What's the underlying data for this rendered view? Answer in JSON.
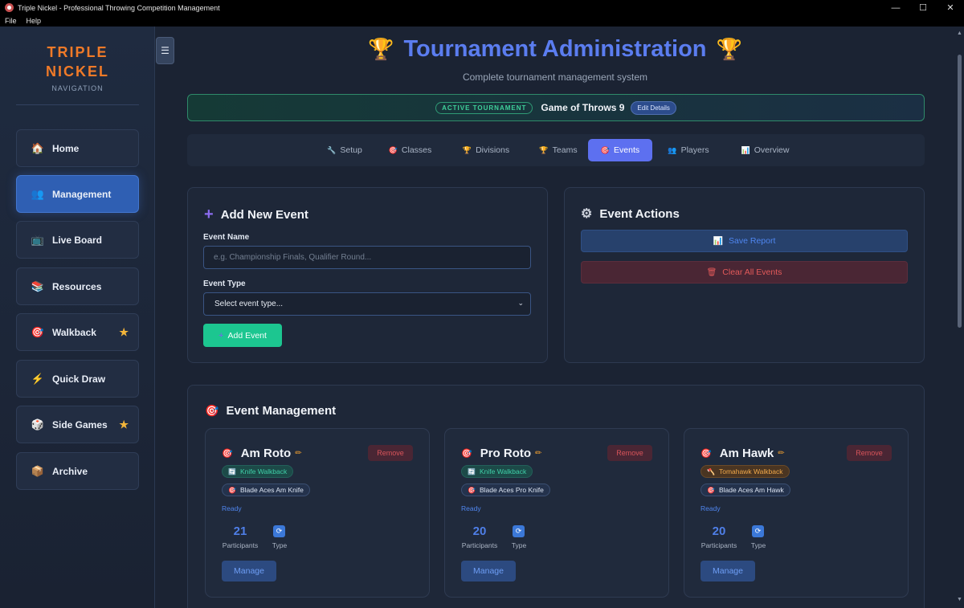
{
  "window": {
    "title": "Triple Nickel - Professional Throwing Competition Management",
    "controls": [
      "—",
      "☐",
      "✕"
    ]
  },
  "menu": [
    "File",
    "Help"
  ],
  "sidebar": {
    "brand_line1": "TRIPLE",
    "brand_line2": "NICKEL",
    "brand_sub": "NAVIGATION",
    "items": [
      {
        "label": "Home",
        "icon": "🏠",
        "icon_name": "home-icon",
        "active": false,
        "star": false
      },
      {
        "label": "Management",
        "icon": "👥",
        "icon_name": "users-icon",
        "active": true,
        "star": false
      },
      {
        "label": "Live Board",
        "icon": "📺",
        "icon_name": "tv-icon",
        "active": false,
        "star": false
      },
      {
        "label": "Resources",
        "icon": "📚",
        "icon_name": "books-icon",
        "active": false,
        "star": false
      },
      {
        "label": "Walkback",
        "icon": "🎯",
        "icon_name": "target-icon",
        "active": false,
        "star": true
      },
      {
        "label": "Quick Draw",
        "icon": "⚡",
        "icon_name": "lightning-icon",
        "active": false,
        "star": false
      },
      {
        "label": "Side Games",
        "icon": "🎲",
        "icon_name": "dice-icon",
        "active": false,
        "star": true
      },
      {
        "label": "Archive",
        "icon": "📦",
        "icon_name": "box-icon",
        "active": false,
        "star": false
      }
    ],
    "star_glyph": "★",
    "toggle_glyph": "☰"
  },
  "header": {
    "title": "Tournament Administration",
    "trophy": "🏆",
    "subtitle": "Complete tournament management system"
  },
  "active_tournament": {
    "badge": "ACTIVE TOURNAMENT",
    "name": "Game of Throws 9",
    "edit_label": "Edit Details"
  },
  "tabs": [
    {
      "label": "Setup",
      "icon": "🔧",
      "active": false
    },
    {
      "label": "Classes",
      "icon": "🎯",
      "active": false
    },
    {
      "label": "Divisions",
      "icon": "🏆",
      "active": false
    },
    {
      "label": "Teams",
      "icon": "🏆",
      "active": false
    },
    {
      "label": "Events",
      "icon": "🎯",
      "active": true
    },
    {
      "label": "Players",
      "icon": "👥",
      "active": false
    },
    {
      "label": "Overview",
      "icon": "📊",
      "active": false
    }
  ],
  "add_event": {
    "title": "Add New Event",
    "title_icon": "+",
    "name_label": "Event Name",
    "name_placeholder": "e.g. Championship Finals, Qualifier Round...",
    "type_label": "Event Type",
    "type_selected": "Select event type...",
    "button_icon": "+",
    "button_label": "Add Event"
  },
  "event_actions": {
    "title": "Event Actions",
    "title_icon": "⚙",
    "save_icon": "📊",
    "save_label": "Save Report",
    "clear_icon": "🗑",
    "clear_label": "Clear All Events"
  },
  "event_management": {
    "title": "Event Management",
    "title_icon": "🎯",
    "events": [
      {
        "name": "Am Roto",
        "type": "Knife Walkback",
        "type_icon": "🔄",
        "class": "Blade Aces Am Knife",
        "status": "Ready",
        "participants": "21",
        "participants_label": "Participants",
        "type_label": "Type",
        "remove_label": "Remove",
        "manage_label": "Manage"
      },
      {
        "name": "Pro Roto",
        "type": "Knife Walkback",
        "type_icon": "🔄",
        "class": "Blade Aces Pro Knife",
        "status": "Ready",
        "participants": "20",
        "participants_label": "Participants",
        "type_label": "Type",
        "remove_label": "Remove",
        "manage_label": "Manage"
      },
      {
        "name": "Am Hawk",
        "type": "Tomahawk Walkback",
        "type_icon": "🪓",
        "class": "Blade Aces Am Hawk",
        "status": "Ready",
        "participants": "20",
        "participants_label": "Participants",
        "type_label": "Type",
        "remove_label": "Remove",
        "manage_label": "Manage"
      }
    ]
  },
  "colors": {
    "accent": "#5d70f0",
    "brand": "#f07a28",
    "success": "#1cc690",
    "danger": "#e35a5a"
  }
}
